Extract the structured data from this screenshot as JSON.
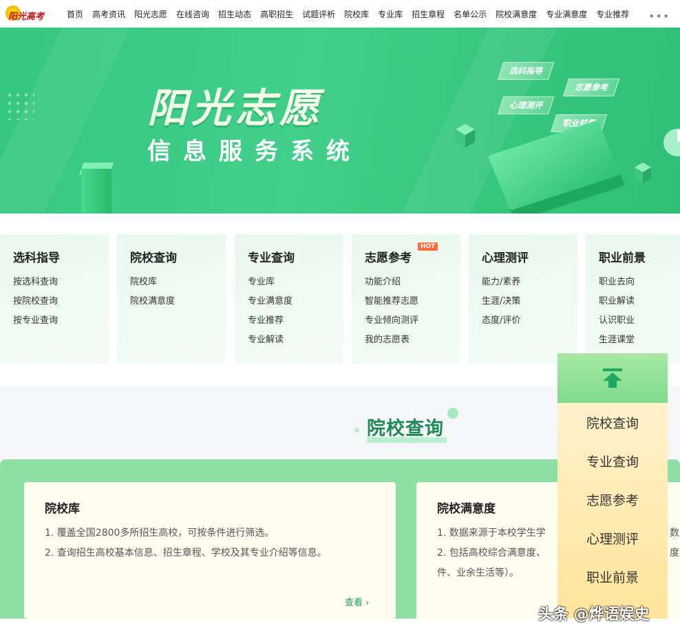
{
  "nav": {
    "logo_text": "阳光高考",
    "items": [
      "首页",
      "高考资讯",
      "阳光志愿",
      "在线咨询",
      "招生动态",
      "高职招生",
      "试题评析",
      "院校库",
      "专业库",
      "招生章程",
      "名单公示",
      "院校满意度",
      "专业满意度",
      "专业推荐"
    ],
    "more": "•••"
  },
  "banner": {
    "title": "阳光志愿",
    "subtitle": "信息服务系统",
    "tags": [
      "选科指导",
      "志愿参考",
      "心理测评",
      "职业前景"
    ]
  },
  "cards": [
    {
      "title": "选科指导",
      "items": [
        "按选科查询",
        "按院校查询",
        "按专业查询"
      ]
    },
    {
      "title": "院校查询",
      "items": [
        "院校库",
        "院校满意度"
      ]
    },
    {
      "title": "专业查询",
      "items": [
        "专业库",
        "专业满意度",
        "专业推荐",
        "专业解读"
      ]
    },
    {
      "title": "志愿参考",
      "badge": "HOT",
      "items": [
        "功能介绍",
        "智能推荐志愿",
        "专业倾向测评",
        "我的志愿表"
      ]
    },
    {
      "title": "心理测评",
      "items": [
        "能力/素养",
        "生涯/决策",
        "态度/评价"
      ]
    },
    {
      "title": "职业前景",
      "items": [
        "职业去向",
        "职业解读",
        "认识职业",
        "生涯课堂"
      ]
    }
  ],
  "section": {
    "title": "院校查询",
    "cards": [
      {
        "title": "院校库",
        "lines": [
          "1. 覆盖全国2800多所招生高校，可按条件进行筛选。",
          "2. 查询招生高校基本信息、招生章程、学校及其专业介绍等信息。"
        ],
        "link": "查看"
      },
      {
        "title": "院校满意度",
        "lines": [
          "1. 数据来源于本校学生学",
          "2. 包括高校综合满意度、",
          "件、业余生活等）。"
        ]
      }
    ],
    "overflow_right": [
      "数",
      "度"
    ]
  },
  "sidebar": {
    "items": [
      "院校查询",
      "专业查询",
      "志愿参考",
      "心理测评",
      "职业前景"
    ]
  },
  "watermark": "头条 @烨语娱史",
  "colors": {
    "brand_green": "#35c77f",
    "accent_dark_green": "#1f8a55",
    "hot": "#ff6a3d"
  }
}
